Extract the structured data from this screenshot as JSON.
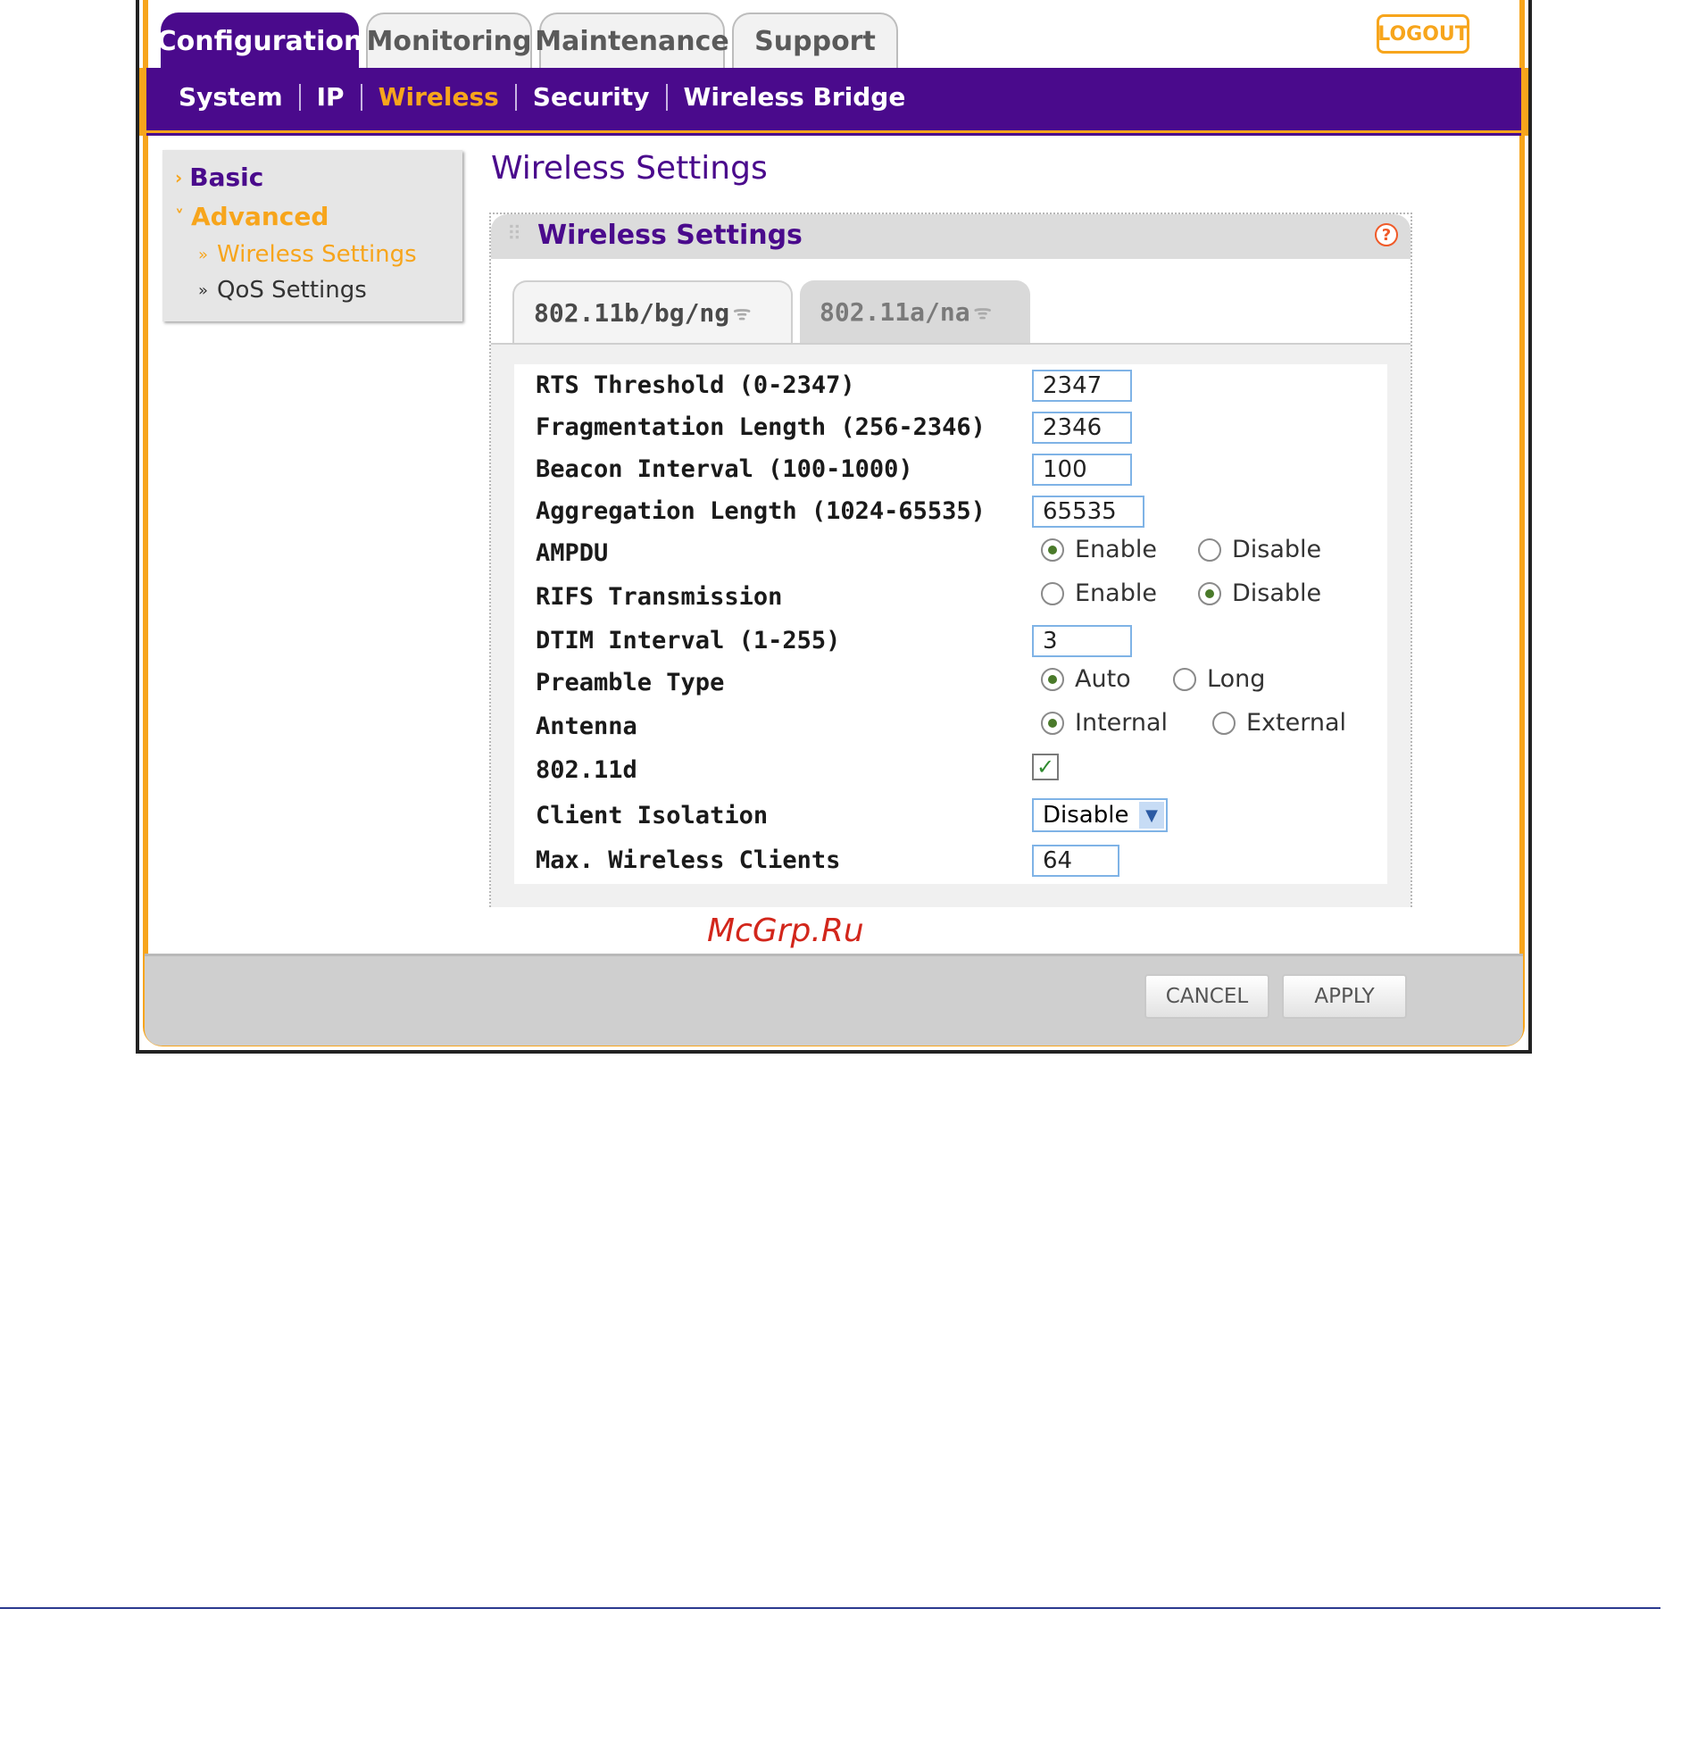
{
  "top_tabs": [
    {
      "label": "Configuration",
      "active": true
    },
    {
      "label": "Monitoring",
      "active": false
    },
    {
      "label": "Maintenance",
      "active": false
    },
    {
      "label": "Support",
      "active": false
    }
  ],
  "logout_label": "LOGOUT",
  "nav": [
    {
      "label": "System",
      "active": false
    },
    {
      "label": "IP",
      "active": false
    },
    {
      "label": "Wireless",
      "active": true
    },
    {
      "label": "Security",
      "active": false
    },
    {
      "label": "Wireless Bridge",
      "active": false
    }
  ],
  "sidebar": {
    "basic": "Basic",
    "advanced": "Advanced",
    "sub_items": [
      {
        "label": "Wireless Settings",
        "active": true
      },
      {
        "label": "QoS Settings",
        "active": false
      }
    ]
  },
  "page_title": "Wireless Settings",
  "panel": {
    "title": "Wireless Settings",
    "help_glyph": "?",
    "tabs": [
      {
        "label": "802.11b/bg/ng",
        "active": true
      },
      {
        "label": "802.11a/na",
        "active": false
      }
    ]
  },
  "form": {
    "rts_label": "RTS Threshold (0-2347)",
    "rts_value": "2347",
    "frag_label": "Fragmentation Length (256-2346)",
    "frag_value": "2346",
    "beacon_label": "Beacon Interval (100-1000)",
    "beacon_value": "100",
    "aggr_label": "Aggregation Length (1024-65535)",
    "aggr_value": "65535",
    "ampdu_label": "AMPDU",
    "ampdu_opt1": "Enable",
    "ampdu_opt2": "Disable",
    "ampdu_selected": "Enable",
    "rifs_label": "RIFS Transmission",
    "rifs_opt1": "Enable",
    "rifs_opt2": "Disable",
    "rifs_selected": "Disable",
    "dtim_label": "DTIM Interval (1-255)",
    "dtim_value": "3",
    "preamble_label": "Preamble Type",
    "preamble_opt1": "Auto",
    "preamble_opt2": "Long",
    "preamble_selected": "Auto",
    "antenna_label": "Antenna",
    "antenna_opt1": "Internal",
    "antenna_opt2": "External",
    "antenna_selected": "Internal",
    "d80211_label": "802.11d",
    "d80211_checked": true,
    "isolation_label": "Client Isolation",
    "isolation_value": "Disable",
    "maxclients_label": "Max. Wireless Clients",
    "maxclients_value": "64"
  },
  "watermark": "McGrp.Ru",
  "buttons": {
    "cancel": "CANCEL",
    "apply": "APPLY"
  },
  "colors": {
    "brand_purple": "#4a0a8c",
    "accent_orange": "#f7a51c"
  }
}
